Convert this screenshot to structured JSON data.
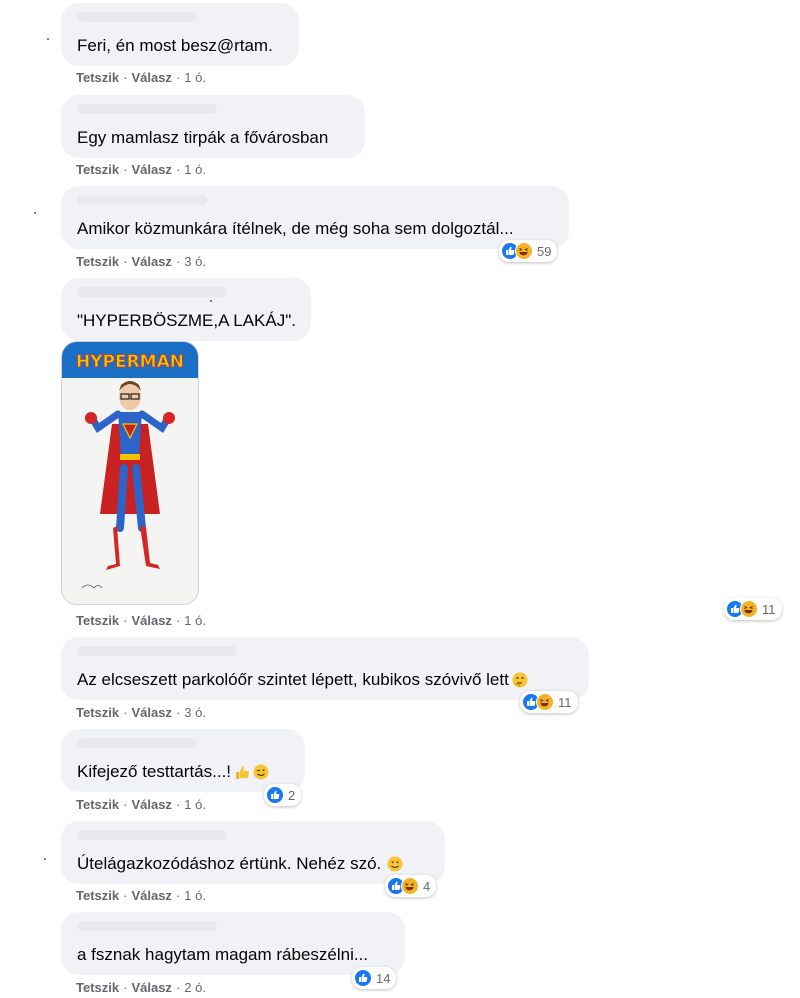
{
  "labels": {
    "like": "Tetszik",
    "reply": "Válasz",
    "separator": "·"
  },
  "comments": [
    {
      "text": "Feri, én most besz@rtam.",
      "time": "1 ó."
    },
    {
      "text": "Egy mamlasz tirpák a fővárosban",
      "time": "1 ó."
    },
    {
      "text": "Amikor közmunkára ítélnek, de még soha sem dolgoztál...",
      "time": "3 ó.",
      "reactions": {
        "types": [
          "like",
          "haha"
        ],
        "count": "59"
      }
    },
    {
      "text": "\"HYPERBÖSZME,A LAKÁJ\".",
      "time": "1 ó.",
      "reactions": {
        "types": [
          "like",
          "haha"
        ],
        "count": "11"
      },
      "image": {
        "title": "HYPERMAN",
        "title_color": "#f5c400",
        "bg_color": "#1a6fc4"
      }
    },
    {
      "text": "Az elcseszett parkolóőr szintet lépett, kubikos szóvivő lett",
      "time": "3 ó.",
      "reactions": {
        "types": [
          "like",
          "haha"
        ],
        "count": "11"
      },
      "emoji": "thinking-emoji"
    },
    {
      "text": "Kifejező testtartás...!",
      "time": "1 ó.",
      "reactions": {
        "types": [
          "like"
        ],
        "count": "2"
      },
      "emoji": "thumbs-up-wink-emoji"
    },
    {
      "text": "Útelágazkozódáshoz értünk. Nehéz szó.",
      "time": "1 ó.",
      "reactions": {
        "types": [
          "like",
          "haha"
        ],
        "count": "4"
      },
      "emoji": "smile-emoji"
    },
    {
      "text": "a fsznak hagytam magam rábeszélni...",
      "time": "2 ó.",
      "reactions": {
        "types": [
          "like"
        ],
        "count": "14"
      }
    }
  ]
}
